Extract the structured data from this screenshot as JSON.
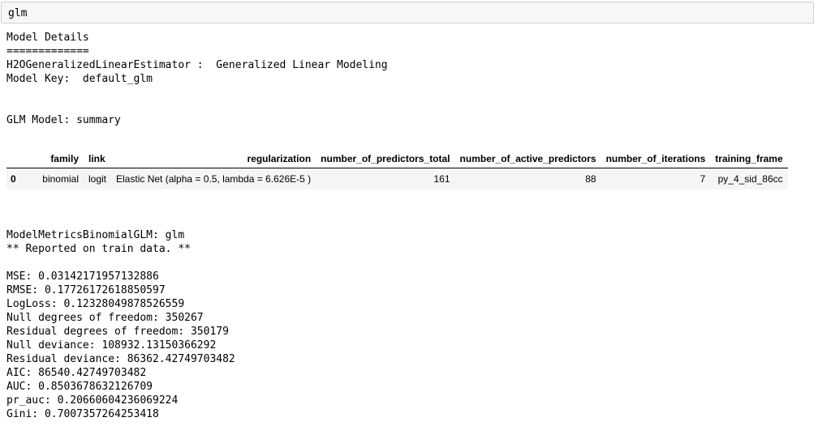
{
  "input_cell": {
    "code": "glm"
  },
  "model_details": {
    "heading": "Model Details",
    "underline": "=============",
    "estimator_line": "H2OGeneralizedLinearEstimator :  Generalized Linear Modeling",
    "model_key_line": "Model Key:  default_glm"
  },
  "summary": {
    "heading": "GLM Model: summary",
    "columns": [
      "",
      "family",
      "link",
      "regularization",
      "number_of_predictors_total",
      "number_of_active_predictors",
      "number_of_iterations",
      "training_frame"
    ],
    "rows": [
      {
        "index": "0",
        "family": "binomial",
        "link": "logit",
        "regularization": "Elastic Net (alpha = 0.5, lambda = 6.626E-5 )",
        "number_of_predictors_total": "161",
        "number_of_active_predictors": "88",
        "number_of_iterations": "7",
        "training_frame": "py_4_sid_86cc"
      }
    ]
  },
  "metrics": {
    "heading": "ModelMetricsBinomialGLM: glm",
    "subheading": "** Reported on train data. **",
    "lines": [
      "MSE: 0.03142171957132886",
      "RMSE: 0.17726172618850597",
      "LogLoss: 0.12328049878526559",
      "Null degrees of freedom: 350267",
      "Residual degrees of freedom: 350179",
      "Null deviance: 108932.13150366292",
      "Residual deviance: 86362.42749703482",
      "AIC: 86540.42749703482",
      "AUC: 0.8503678632126709",
      "pr_auc: 0.20660604236069224",
      "Gini: 0.7007357264253418"
    ]
  }
}
